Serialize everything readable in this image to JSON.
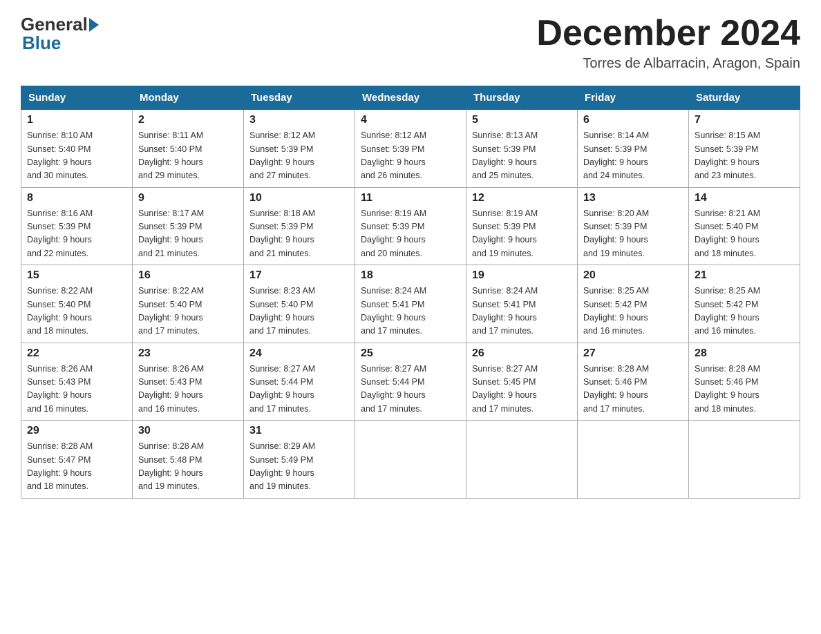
{
  "header": {
    "logo_general": "General",
    "logo_blue": "Blue",
    "month_title": "December 2024",
    "location": "Torres de Albarracin, Aragon, Spain"
  },
  "days_of_week": [
    "Sunday",
    "Monday",
    "Tuesday",
    "Wednesday",
    "Thursday",
    "Friday",
    "Saturday"
  ],
  "weeks": [
    [
      {
        "day": "1",
        "sunrise": "8:10 AM",
        "sunset": "5:40 PM",
        "daylight": "9 hours and 30 minutes."
      },
      {
        "day": "2",
        "sunrise": "8:11 AM",
        "sunset": "5:40 PM",
        "daylight": "9 hours and 29 minutes."
      },
      {
        "day": "3",
        "sunrise": "8:12 AM",
        "sunset": "5:39 PM",
        "daylight": "9 hours and 27 minutes."
      },
      {
        "day": "4",
        "sunrise": "8:12 AM",
        "sunset": "5:39 PM",
        "daylight": "9 hours and 26 minutes."
      },
      {
        "day": "5",
        "sunrise": "8:13 AM",
        "sunset": "5:39 PM",
        "daylight": "9 hours and 25 minutes."
      },
      {
        "day": "6",
        "sunrise": "8:14 AM",
        "sunset": "5:39 PM",
        "daylight": "9 hours and 24 minutes."
      },
      {
        "day": "7",
        "sunrise": "8:15 AM",
        "sunset": "5:39 PM",
        "daylight": "9 hours and 23 minutes."
      }
    ],
    [
      {
        "day": "8",
        "sunrise": "8:16 AM",
        "sunset": "5:39 PM",
        "daylight": "9 hours and 22 minutes."
      },
      {
        "day": "9",
        "sunrise": "8:17 AM",
        "sunset": "5:39 PM",
        "daylight": "9 hours and 21 minutes."
      },
      {
        "day": "10",
        "sunrise": "8:18 AM",
        "sunset": "5:39 PM",
        "daylight": "9 hours and 21 minutes."
      },
      {
        "day": "11",
        "sunrise": "8:19 AM",
        "sunset": "5:39 PM",
        "daylight": "9 hours and 20 minutes."
      },
      {
        "day": "12",
        "sunrise": "8:19 AM",
        "sunset": "5:39 PM",
        "daylight": "9 hours and 19 minutes."
      },
      {
        "day": "13",
        "sunrise": "8:20 AM",
        "sunset": "5:39 PM",
        "daylight": "9 hours and 19 minutes."
      },
      {
        "day": "14",
        "sunrise": "8:21 AM",
        "sunset": "5:40 PM",
        "daylight": "9 hours and 18 minutes."
      }
    ],
    [
      {
        "day": "15",
        "sunrise": "8:22 AM",
        "sunset": "5:40 PM",
        "daylight": "9 hours and 18 minutes."
      },
      {
        "day": "16",
        "sunrise": "8:22 AM",
        "sunset": "5:40 PM",
        "daylight": "9 hours and 17 minutes."
      },
      {
        "day": "17",
        "sunrise": "8:23 AM",
        "sunset": "5:40 PM",
        "daylight": "9 hours and 17 minutes."
      },
      {
        "day": "18",
        "sunrise": "8:24 AM",
        "sunset": "5:41 PM",
        "daylight": "9 hours and 17 minutes."
      },
      {
        "day": "19",
        "sunrise": "8:24 AM",
        "sunset": "5:41 PM",
        "daylight": "9 hours and 17 minutes."
      },
      {
        "day": "20",
        "sunrise": "8:25 AM",
        "sunset": "5:42 PM",
        "daylight": "9 hours and 16 minutes."
      },
      {
        "day": "21",
        "sunrise": "8:25 AM",
        "sunset": "5:42 PM",
        "daylight": "9 hours and 16 minutes."
      }
    ],
    [
      {
        "day": "22",
        "sunrise": "8:26 AM",
        "sunset": "5:43 PM",
        "daylight": "9 hours and 16 minutes."
      },
      {
        "day": "23",
        "sunrise": "8:26 AM",
        "sunset": "5:43 PM",
        "daylight": "9 hours and 16 minutes."
      },
      {
        "day": "24",
        "sunrise": "8:27 AM",
        "sunset": "5:44 PM",
        "daylight": "9 hours and 17 minutes."
      },
      {
        "day": "25",
        "sunrise": "8:27 AM",
        "sunset": "5:44 PM",
        "daylight": "9 hours and 17 minutes."
      },
      {
        "day": "26",
        "sunrise": "8:27 AM",
        "sunset": "5:45 PM",
        "daylight": "9 hours and 17 minutes."
      },
      {
        "day": "27",
        "sunrise": "8:28 AM",
        "sunset": "5:46 PM",
        "daylight": "9 hours and 17 minutes."
      },
      {
        "day": "28",
        "sunrise": "8:28 AM",
        "sunset": "5:46 PM",
        "daylight": "9 hours and 18 minutes."
      }
    ],
    [
      {
        "day": "29",
        "sunrise": "8:28 AM",
        "sunset": "5:47 PM",
        "daylight": "9 hours and 18 minutes."
      },
      {
        "day": "30",
        "sunrise": "8:28 AM",
        "sunset": "5:48 PM",
        "daylight": "9 hours and 19 minutes."
      },
      {
        "day": "31",
        "sunrise": "8:29 AM",
        "sunset": "5:49 PM",
        "daylight": "9 hours and 19 minutes."
      },
      null,
      null,
      null,
      null
    ]
  ]
}
